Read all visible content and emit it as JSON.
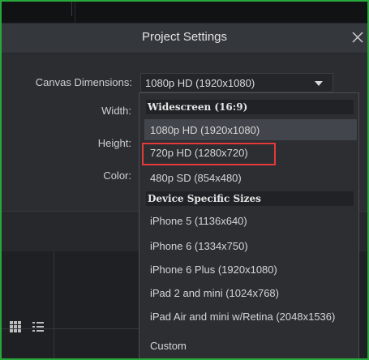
{
  "dialog": {
    "title": "Project Settings"
  },
  "fields": {
    "canvas_label": "Canvas Dimensions:",
    "canvas_value": "1080p HD (1920x1080)",
    "width_label": "Width:",
    "height_label": "Height:",
    "color_label": "Color:"
  },
  "dropdown": {
    "groups": [
      {
        "header": "Widescreen (16:9)",
        "items": [
          "1080p HD (1920x1080)",
          "720p HD (1280x720)",
          "480p SD (854x480)"
        ]
      },
      {
        "header": "Device Specific Sizes",
        "items": [
          "iPhone 5 (1136x640)",
          "iPhone 6 (1334x750)",
          "iPhone 6 Plus (1920x1080)",
          "iPad 2 and mini (1024x768)",
          "iPad Air and mini w/Retina (2048x1536)",
          "Custom"
        ]
      }
    ],
    "selected_item": "1080p HD (1920x1080)",
    "highlighted_item": "720p HD (1280x720)"
  },
  "colors": {
    "frame": "#27a83b",
    "highlight": "#e53a3a"
  },
  "icons": [
    "close-icon",
    "dropdown-caret-icon",
    "grid-view-icon",
    "list-view-icon"
  ]
}
